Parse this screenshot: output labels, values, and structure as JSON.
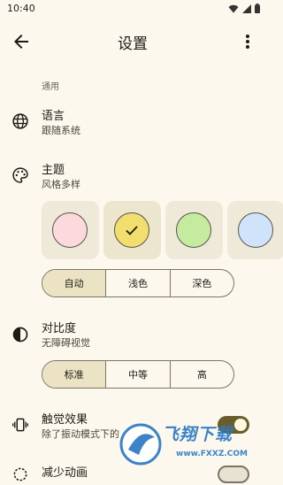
{
  "status_bar": {
    "time": "10:40"
  },
  "header": {
    "title": "设置"
  },
  "section": {
    "label": "通用"
  },
  "language": {
    "title": "语言",
    "subtitle": "跟随系统"
  },
  "theme": {
    "title": "主题",
    "subtitle": "风格多样",
    "swatches": [
      {
        "name": "pink",
        "color": "#fcd9dc",
        "selected": false
      },
      {
        "name": "yellow",
        "color": "#f2dd6f",
        "selected": true
      },
      {
        "name": "green",
        "color": "#c4eb9e",
        "selected": false
      },
      {
        "name": "blue",
        "color": "#cfe4fb",
        "selected": false
      }
    ],
    "modes": [
      "自动",
      "浅色",
      "深色"
    ],
    "selected_mode": "自动"
  },
  "contrast": {
    "title": "对比度",
    "subtitle": "无障碍视觉",
    "options": [
      "标准",
      "中等",
      "高"
    ],
    "selected_option": "标准"
  },
  "haptics": {
    "title": "触觉效果",
    "subtitle": "除了振动模式下的",
    "enabled": true
  },
  "reduce_motion": {
    "title": "减少动画",
    "enabled": false
  },
  "watermark": {
    "text": "飞翔下载",
    "url": "www.FXXZ.COM"
  },
  "colors": {
    "background": "#fcf8ee",
    "accent": "#6a5d2c",
    "segment_active": "#ece3c4"
  }
}
